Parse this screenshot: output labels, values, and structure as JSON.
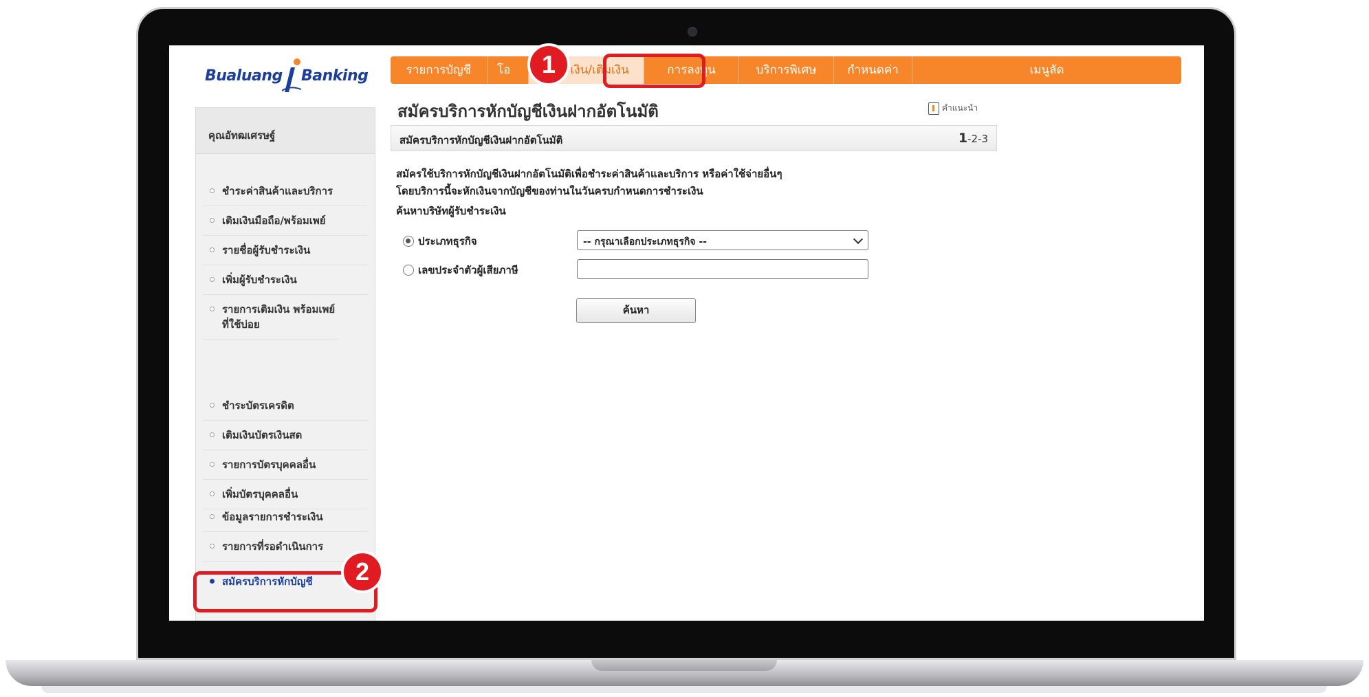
{
  "logo": {
    "left_text": "Bualuang",
    "right_text": "Banking"
  },
  "topnav": {
    "items": [
      {
        "label": "รายการบัญชี"
      },
      {
        "label": "โอ"
      },
      {
        "label": "ชำระเงิน/เติมเงิน",
        "active": true
      },
      {
        "label": "การลงทุน"
      },
      {
        "label": "บริการพิเศษ"
      },
      {
        "label": "กำหนดค่า"
      },
      {
        "label": "เมนูลัด"
      }
    ]
  },
  "sidebar": {
    "user": "คุณอัทฒเศรษฐ์",
    "group1": [
      {
        "label": "ชำระค่าสินค้าและบริการ"
      },
      {
        "label": "เติมเงินมือถือ/พร้อมเพย์"
      },
      {
        "label": "รายชื่อผู้รับชำระเงิน"
      },
      {
        "label": "เพิ่มผู้รับชำระเงิน"
      },
      {
        "label": "รายการเติมเงิน พร้อมเพย์ที่ใช้บ่อย"
      }
    ],
    "group2": [
      {
        "label": "ชำระบัตรเครดิต"
      },
      {
        "label": "เติมเงินบัตรเงินสด"
      },
      {
        "label": "รายการบัตรบุคคลอื่น"
      },
      {
        "label": "เพิ่มบัตรบุคคลอื่น"
      }
    ],
    "group3": [
      {
        "label": "ข้อมูลรายการชำระเงิน"
      },
      {
        "label": "รายการที่รอดำเนินการ"
      }
    ],
    "active_item": {
      "label": "สมัครบริการหักบัญชี"
    }
  },
  "main": {
    "title": "สมัครบริการหักบัญชีเงินฝากอัตโนมัติ",
    "help_label": "คำแนะนำ",
    "section_title": "สมัครบริการหักบัญชีเงินฝากอัตโนมัติ",
    "step_current": "1",
    "step_rest": "-2-3",
    "desc_line1": "สมัครใช้บริการหักบัญชีเงินฝากอัตโนมัติเพื่อชำระค่าสินค้าและบริการ หรือค่าใช้จ่ายอื่นๆ",
    "desc_line2": "โดยบริการนี้จะหักเงินจากบัญชีของท่านในวันครบกำหนดการชำระเงิน",
    "search_heading": "ค้นหาบริษัทผู้รับชำระเงิน",
    "radio_business": "ประเภทธุรกิจ",
    "radio_taxid": "เลขประจำตัวผู้เสียภาษี",
    "select_value": "-- กรุณาเลือกประเภทธุรกิจ --",
    "taxid_value": "",
    "search_button": "ค้นหา"
  },
  "callouts": {
    "first": "1",
    "second": "2",
    "color": "#e01b22"
  },
  "colors": {
    "nav_orange": "#f7862a",
    "brand_blue": "#1b3f9b"
  }
}
